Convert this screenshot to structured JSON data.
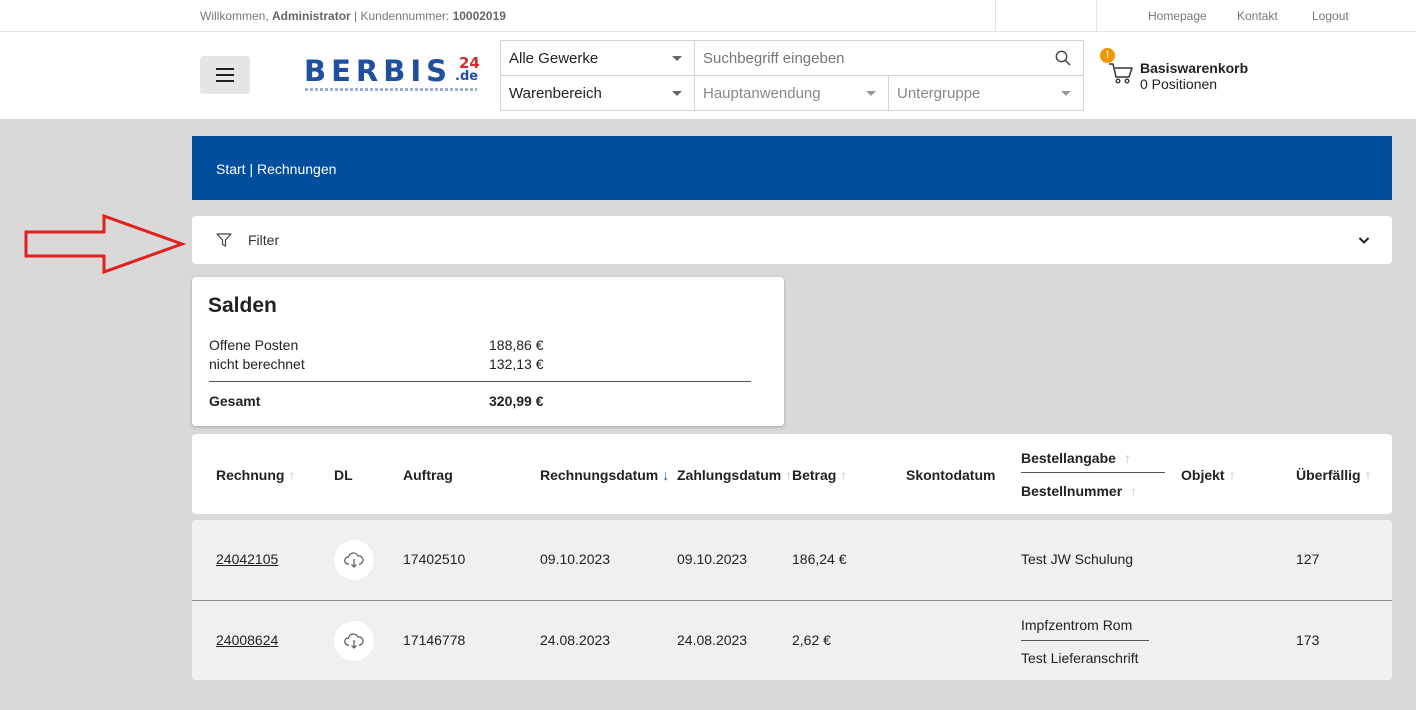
{
  "topbar": {
    "welcome_prefix": "Willkommen,",
    "user": "Administrator",
    "customer_label": "| Kundennummer:",
    "customer_number": "10002019",
    "links": [
      "Homepage",
      "Kontakt",
      "Logout"
    ]
  },
  "header": {
    "logo_text": "BERBIS",
    "logo_sup": "24",
    "logo_tld": ".de",
    "search": {
      "gewerke": "Alle Gewerke",
      "placeholder": "Suchbegriff eingeben",
      "warenbereich": "Warenbereich",
      "hauptanwendung": "Hauptanwendung",
      "untergruppe": "Untergruppe"
    },
    "cart": {
      "badge": "!",
      "title": "Basiswarenkorb",
      "count": "0 Positionen"
    }
  },
  "breadcrumb": {
    "start": "Start",
    "separator": "|",
    "current": "Rechnungen"
  },
  "filter": {
    "label": "Filter"
  },
  "salden": {
    "title": "Salden",
    "rows": [
      {
        "label": "Offene Posten",
        "value": "188,86 €"
      },
      {
        "label": "nicht berechnet",
        "value": "132,13 €"
      }
    ],
    "total": {
      "label": "Gesamt",
      "value": "320,99 €"
    }
  },
  "table": {
    "headers": {
      "rechnung": "Rechnung",
      "dl": "DL",
      "auftrag": "Auftrag",
      "rechnungsdatum": "Rechnungsdatum",
      "zahlungsdatum": "Zahlungsdatum",
      "betrag": "Betrag",
      "skontodatum": "Skontodatum",
      "bestellangabe": "Bestellangabe",
      "bestellnummer": "Bestellnummer",
      "objekt": "Objekt",
      "ueberfaellig": "Überfällig"
    },
    "sort_up": "↑",
    "sort_down": "↓",
    "rows": [
      {
        "rechnung": "24042105",
        "auftrag": "17402510",
        "rechnungsdatum": "09.10.2023",
        "zahlungsdatum": "09.10.2023",
        "betrag": "186,24 €",
        "bestellangabe": "Test JW Schulung",
        "bestellnummer": "",
        "ueberfaellig": "127"
      },
      {
        "rechnung": "24008624",
        "auftrag": "17146778",
        "rechnungsdatum": "24.08.2023",
        "zahlungsdatum": "24.08.2023",
        "betrag": "2,62 €",
        "bestellangabe": "Impfzentrom Rom",
        "bestellnummer": "Test Lieferanschrift",
        "ueberfaellig": "173"
      }
    ]
  },
  "colors": {
    "brand_blue": "#004e9e",
    "logo_red": "#d62b2b",
    "badge_orange": "#f29400",
    "annotation_arrow": "#e02020"
  }
}
